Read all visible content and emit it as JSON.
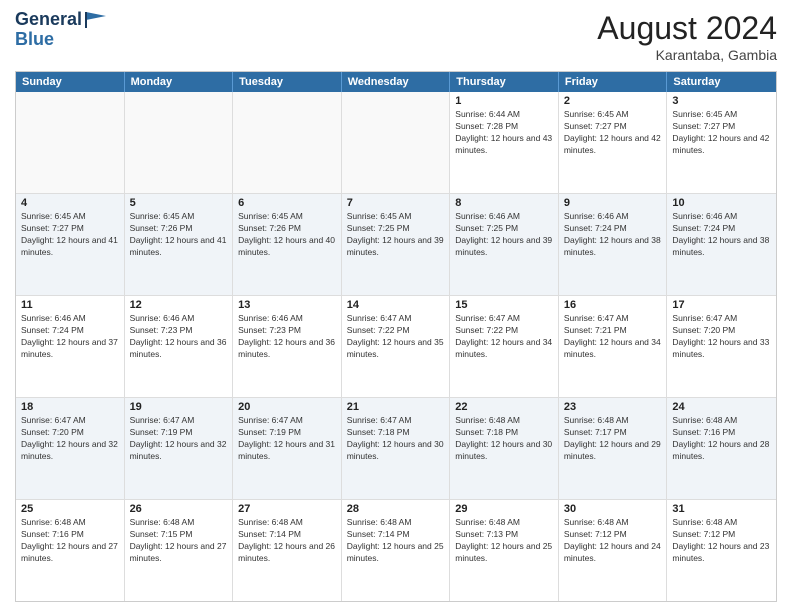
{
  "header": {
    "logo_line1": "General",
    "logo_line2": "Blue",
    "month_year": "August 2024",
    "location": "Karantaba, Gambia"
  },
  "weekdays": [
    "Sunday",
    "Monday",
    "Tuesday",
    "Wednesday",
    "Thursday",
    "Friday",
    "Saturday"
  ],
  "rows": [
    [
      {
        "day": "",
        "empty": true
      },
      {
        "day": "",
        "empty": true
      },
      {
        "day": "",
        "empty": true
      },
      {
        "day": "",
        "empty": true
      },
      {
        "day": "1",
        "sunrise": "6:44 AM",
        "sunset": "7:28 PM",
        "daylight": "12 hours and 43 minutes."
      },
      {
        "day": "2",
        "sunrise": "6:45 AM",
        "sunset": "7:27 PM",
        "daylight": "12 hours and 42 minutes."
      },
      {
        "day": "3",
        "sunrise": "6:45 AM",
        "sunset": "7:27 PM",
        "daylight": "12 hours and 42 minutes."
      }
    ],
    [
      {
        "day": "4",
        "sunrise": "6:45 AM",
        "sunset": "7:27 PM",
        "daylight": "12 hours and 41 minutes."
      },
      {
        "day": "5",
        "sunrise": "6:45 AM",
        "sunset": "7:26 PM",
        "daylight": "12 hours and 41 minutes."
      },
      {
        "day": "6",
        "sunrise": "6:45 AM",
        "sunset": "7:26 PM",
        "daylight": "12 hours and 40 minutes."
      },
      {
        "day": "7",
        "sunrise": "6:45 AM",
        "sunset": "7:25 PM",
        "daylight": "12 hours and 39 minutes."
      },
      {
        "day": "8",
        "sunrise": "6:46 AM",
        "sunset": "7:25 PM",
        "daylight": "12 hours and 39 minutes."
      },
      {
        "day": "9",
        "sunrise": "6:46 AM",
        "sunset": "7:24 PM",
        "daylight": "12 hours and 38 minutes."
      },
      {
        "day": "10",
        "sunrise": "6:46 AM",
        "sunset": "7:24 PM",
        "daylight": "12 hours and 38 minutes."
      }
    ],
    [
      {
        "day": "11",
        "sunrise": "6:46 AM",
        "sunset": "7:24 PM",
        "daylight": "12 hours and 37 minutes."
      },
      {
        "day": "12",
        "sunrise": "6:46 AM",
        "sunset": "7:23 PM",
        "daylight": "12 hours and 36 minutes."
      },
      {
        "day": "13",
        "sunrise": "6:46 AM",
        "sunset": "7:23 PM",
        "daylight": "12 hours and 36 minutes."
      },
      {
        "day": "14",
        "sunrise": "6:47 AM",
        "sunset": "7:22 PM",
        "daylight": "12 hours and 35 minutes."
      },
      {
        "day": "15",
        "sunrise": "6:47 AM",
        "sunset": "7:22 PM",
        "daylight": "12 hours and 34 minutes."
      },
      {
        "day": "16",
        "sunrise": "6:47 AM",
        "sunset": "7:21 PM",
        "daylight": "12 hours and 34 minutes."
      },
      {
        "day": "17",
        "sunrise": "6:47 AM",
        "sunset": "7:20 PM",
        "daylight": "12 hours and 33 minutes."
      }
    ],
    [
      {
        "day": "18",
        "sunrise": "6:47 AM",
        "sunset": "7:20 PM",
        "daylight": "12 hours and 32 minutes."
      },
      {
        "day": "19",
        "sunrise": "6:47 AM",
        "sunset": "7:19 PM",
        "daylight": "12 hours and 32 minutes."
      },
      {
        "day": "20",
        "sunrise": "6:47 AM",
        "sunset": "7:19 PM",
        "daylight": "12 hours and 31 minutes."
      },
      {
        "day": "21",
        "sunrise": "6:47 AM",
        "sunset": "7:18 PM",
        "daylight": "12 hours and 30 minutes."
      },
      {
        "day": "22",
        "sunrise": "6:48 AM",
        "sunset": "7:18 PM",
        "daylight": "12 hours and 30 minutes."
      },
      {
        "day": "23",
        "sunrise": "6:48 AM",
        "sunset": "7:17 PM",
        "daylight": "12 hours and 29 minutes."
      },
      {
        "day": "24",
        "sunrise": "6:48 AM",
        "sunset": "7:16 PM",
        "daylight": "12 hours and 28 minutes."
      }
    ],
    [
      {
        "day": "25",
        "sunrise": "6:48 AM",
        "sunset": "7:16 PM",
        "daylight": "12 hours and 27 minutes."
      },
      {
        "day": "26",
        "sunrise": "6:48 AM",
        "sunset": "7:15 PM",
        "daylight": "12 hours and 27 minutes."
      },
      {
        "day": "27",
        "sunrise": "6:48 AM",
        "sunset": "7:14 PM",
        "daylight": "12 hours and 26 minutes."
      },
      {
        "day": "28",
        "sunrise": "6:48 AM",
        "sunset": "7:14 PM",
        "daylight": "12 hours and 25 minutes."
      },
      {
        "day": "29",
        "sunrise": "6:48 AM",
        "sunset": "7:13 PM",
        "daylight": "12 hours and 25 minutes."
      },
      {
        "day": "30",
        "sunrise": "6:48 AM",
        "sunset": "7:12 PM",
        "daylight": "12 hours and 24 minutes."
      },
      {
        "day": "31",
        "sunrise": "6:48 AM",
        "sunset": "7:12 PM",
        "daylight": "12 hours and 23 minutes."
      }
    ]
  ]
}
